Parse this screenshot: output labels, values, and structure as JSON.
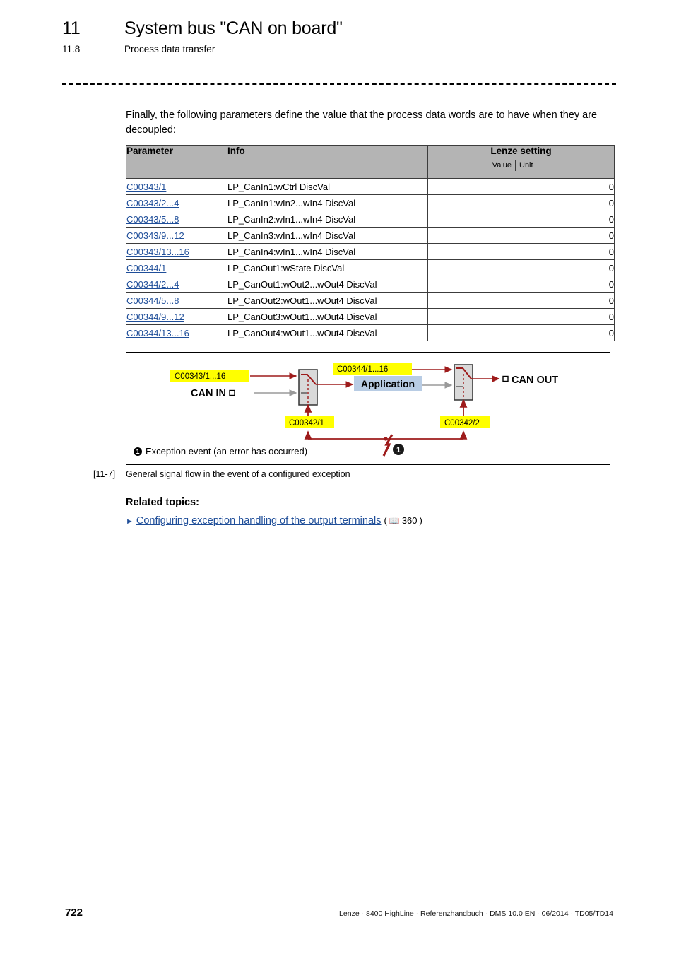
{
  "header": {
    "chapter_number": "11",
    "chapter_title": "System bus \"CAN on board\"",
    "section_number": "11.8",
    "section_title": "Process data transfer"
  },
  "intro": {
    "text": "Finally, the following parameters define the value that the process data words are to have when they are decoupled:"
  },
  "table": {
    "headers": {
      "parameter": "Parameter",
      "info": "Info",
      "lenze_setting": "Lenze setting",
      "value": "Value",
      "unit": "Unit"
    },
    "rows": [
      {
        "parameter": "C00343/1",
        "info": "LP_CanIn1:wCtrl DiscVal",
        "value": "0",
        "unit": ""
      },
      {
        "parameter": "C00343/2...4",
        "info": "LP_CanIn1:wIn2...wIn4 DiscVal",
        "value": "0",
        "unit": ""
      },
      {
        "parameter": "C00343/5...8",
        "info": "LP_CanIn2:wIn1...wIn4 DiscVal",
        "value": "0",
        "unit": ""
      },
      {
        "parameter": "C00343/9...12",
        "info": "LP_CanIn3:wIn1...wIn4 DiscVal",
        "value": "0",
        "unit": ""
      },
      {
        "parameter": "C00343/13...16",
        "info": "LP_CanIn4:wIn1...wIn4 DiscVal",
        "value": "0",
        "unit": ""
      },
      {
        "parameter": "C00344/1",
        "info": "LP_CanOut1:wState DiscVal",
        "value": "0",
        "unit": ""
      },
      {
        "parameter": "C00344/2...4",
        "info": "LP_CanOut1:wOut2...wOut4 DiscVal",
        "value": "0",
        "unit": ""
      },
      {
        "parameter": "C00344/5...8",
        "info": "LP_CanOut2:wOut1...wOut4 DiscVal",
        "value": "0",
        "unit": ""
      },
      {
        "parameter": "C00344/9...12",
        "info": "LP_CanOut3:wOut1...wOut4 DiscVal",
        "value": "0",
        "unit": ""
      },
      {
        "parameter": "C00344/13...16",
        "info": "LP_CanOut4:wOut1...wOut4 DiscVal",
        "value": "0",
        "unit": ""
      }
    ]
  },
  "figure": {
    "labels": {
      "can_in": "CAN IN",
      "can_out": "CAN OUT",
      "application": "Application",
      "param_in": "C00343/1...16",
      "param_out": "C00344/1...16",
      "param_switch_in": "C00342/1",
      "param_switch_out": "C00342/2"
    },
    "legend": {
      "marker": "1",
      "text": "Exception event (an error has occurred)"
    },
    "caption": {
      "number": "[11-7]",
      "text": "General signal flow in the event of a configured exception"
    },
    "colors": {
      "signal_red": "#9e1b1b",
      "signal_gray": "#9a9a9a",
      "highlight_yellow": "#ffff00",
      "application_blue": "#b8cce4",
      "switch_gray": "#d9d9d9"
    }
  },
  "related": {
    "title": "Related topics:",
    "link_text": "Configuring exception handling of the output terminals",
    "page_icon": "book-icon",
    "page_number": "360"
  },
  "footer": {
    "page_number": "722",
    "info": "Lenze · 8400 HighLine · Referenzhandbuch · DMS 10.0 EN · 06/2014 · TD05/TD14"
  }
}
